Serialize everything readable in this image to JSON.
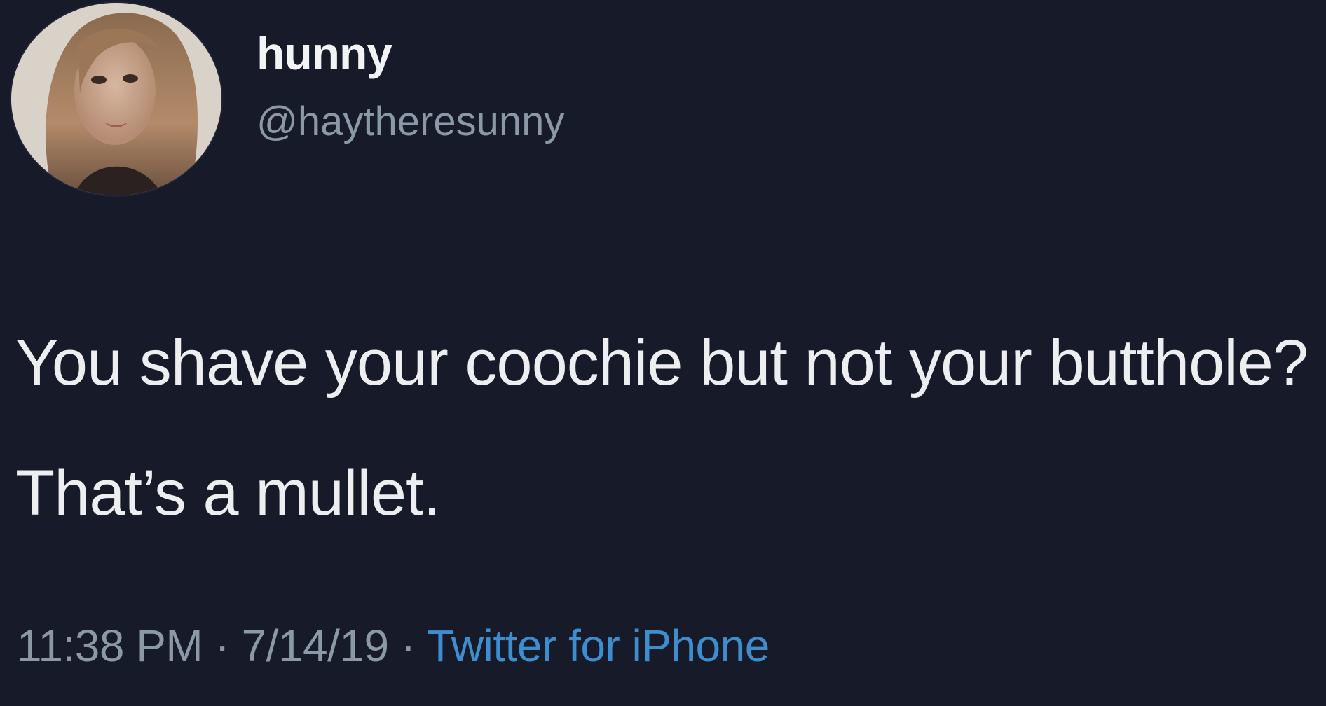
{
  "tweet": {
    "display_name": "hunny",
    "handle": "@haytheresunny",
    "text": "You shave your coochie but not your butthole? That’s a mullet.",
    "time": "11:38 PM",
    "date": "7/14/19",
    "separator": " · ",
    "source": "Twitter for iPhone"
  },
  "colors": {
    "background": "#161a29",
    "name": "#f1f3f5",
    "secondary": "#8b98a5",
    "link": "#3e8ecf"
  },
  "icons": {
    "avatar": "profile-photo"
  }
}
